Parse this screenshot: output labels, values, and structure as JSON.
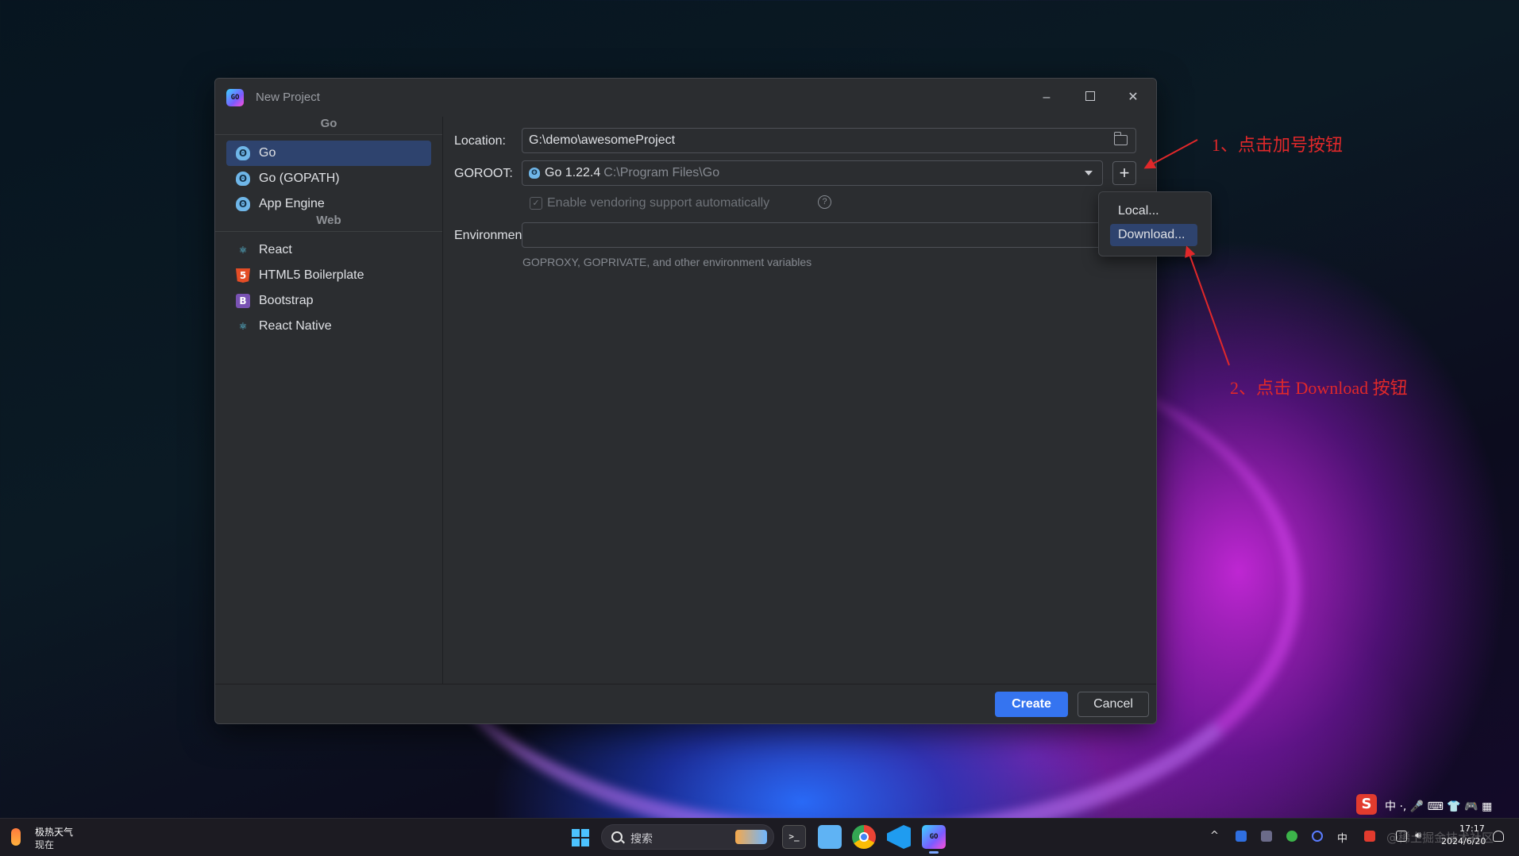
{
  "dialog": {
    "title": "New Project",
    "app_icon_text": "GO",
    "minimize_glyph": "–",
    "close_glyph": "✕"
  },
  "sidebar": {
    "groups": [
      {
        "label": "Go",
        "items": [
          {
            "label": "Go",
            "icon": "gopher-icon",
            "selected": true
          },
          {
            "label": "Go (GOPATH)",
            "icon": "gopher-icon"
          },
          {
            "label": "App Engine",
            "icon": "app-engine-icon"
          }
        ]
      },
      {
        "label": "Web",
        "items": [
          {
            "label": "React",
            "icon": "react-icon"
          },
          {
            "label": "HTML5 Boilerplate",
            "icon": "html5-icon"
          },
          {
            "label": "Bootstrap",
            "icon": "bootstrap-icon"
          },
          {
            "label": "React Native",
            "icon": "react-icon"
          }
        ]
      }
    ]
  },
  "form": {
    "location_label": "Location:",
    "location_value": "G:\\demo\\awesomeProject",
    "goroot_label": "GOROOT:",
    "goroot_version": "Go 1.22.4",
    "goroot_path": "C:\\Program Files\\Go",
    "plus_glyph": "+",
    "vendoring_label": "Enable vendoring support automatically",
    "vendoring_checked": true,
    "help_glyph": "?",
    "environment_label": "Environment:",
    "environment_value": "",
    "environment_hint": "GOPROXY, GOPRIVATE, and other environment variables"
  },
  "popup": {
    "items": [
      {
        "label": "Local...",
        "active": false
      },
      {
        "label": "Download...",
        "active": true
      }
    ]
  },
  "footer": {
    "create_label": "Create",
    "cancel_label": "Cancel"
  },
  "annotations": {
    "step1": "1、点击加号按钮",
    "step2": "2、点击 Download 按钮",
    "color": "#e0282a"
  },
  "taskbar": {
    "weather_title": "极热天气",
    "weather_sub": "现在",
    "search_text": "搜索",
    "terminal_glyph": ">_",
    "goland_text": "GO",
    "ime_logo": "S",
    "ime_text": "中 ·, 🎤 ⌨ 👕 🎮 ▦",
    "tray_lang": "中",
    "tray_chevron": "^",
    "clock_time": "17:17",
    "clock_date": "2024/6/20",
    "watermark": "@稀土掘金技术社区"
  },
  "colors": {
    "accent": "#3574f0",
    "selection": "#2e436e",
    "dialog_bg": "#2b2d30"
  }
}
